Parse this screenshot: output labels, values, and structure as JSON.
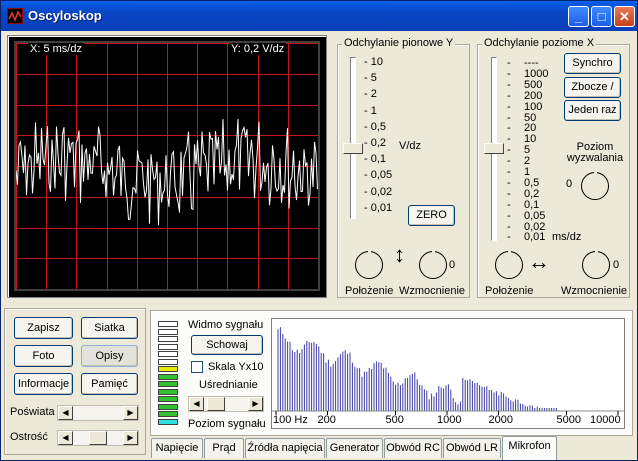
{
  "window": {
    "title": "Oscyloskop",
    "min": "_",
    "max": "□",
    "close": "✕"
  },
  "screen": {
    "x_label": "X: 5  ms/dz",
    "y_label": "Y: 0,2  V/dz"
  },
  "vertical": {
    "title": "Odchylanie pionowe Y",
    "ticks": [
      "10",
      "5",
      "2",
      "1",
      "0,5",
      "0,2",
      "0,1",
      "0,05",
      "0,02",
      "0,01"
    ],
    "unit": "V/dz",
    "zero_label": "ZERO",
    "position_label": "Położenie",
    "gain_label": "Wzmocnienie",
    "gain_value": "0",
    "arrow": "↕"
  },
  "horizontal": {
    "title": "Odchylanie poziome X",
    "ticks": [
      "----",
      "1000",
      "500",
      "200",
      "100",
      "50",
      "20",
      "10",
      "5",
      "2",
      "1",
      "0,5",
      "0,2",
      "0,1",
      "0,05",
      "0,02",
      "0,01"
    ],
    "unit": "ms/dz",
    "sync_label": "Synchro",
    "edge_label": "Zbocze /",
    "once_label": "Jeden raz",
    "trigger_label": "Poziom\nwyzwalania",
    "trigger_value": "0",
    "position_label": "Położenie",
    "gain_label": "Wzmocnienie",
    "gain_value": "0",
    "arrow": "↔"
  },
  "controls": {
    "save": "Zapisz",
    "grid": "Siatka",
    "photo": "Foto",
    "descr": "Opisy",
    "info": "Informacje",
    "memory": "Pamięć",
    "glow": "Poświata",
    "sharp": "Ostrość"
  },
  "spectrum": {
    "title": "Widmo sygnału",
    "hide": "Schowaj",
    "scale": "Skala Yx10",
    "avg": "Uśrednianie",
    "level": "Poziom sygnału",
    "axis": [
      "100 Hz",
      "200",
      "500",
      "1000",
      "2000",
      "5000",
      "10000"
    ]
  },
  "tabs": [
    "Napięcie",
    "Prąd",
    "Źródła napięcia",
    "Generator",
    "Obwód RC",
    "Obwód LR",
    "Mikrofon"
  ],
  "colors": {
    "grid": "#c81414",
    "trace": "#ffffff",
    "spectrum": "#3c3ca0"
  }
}
